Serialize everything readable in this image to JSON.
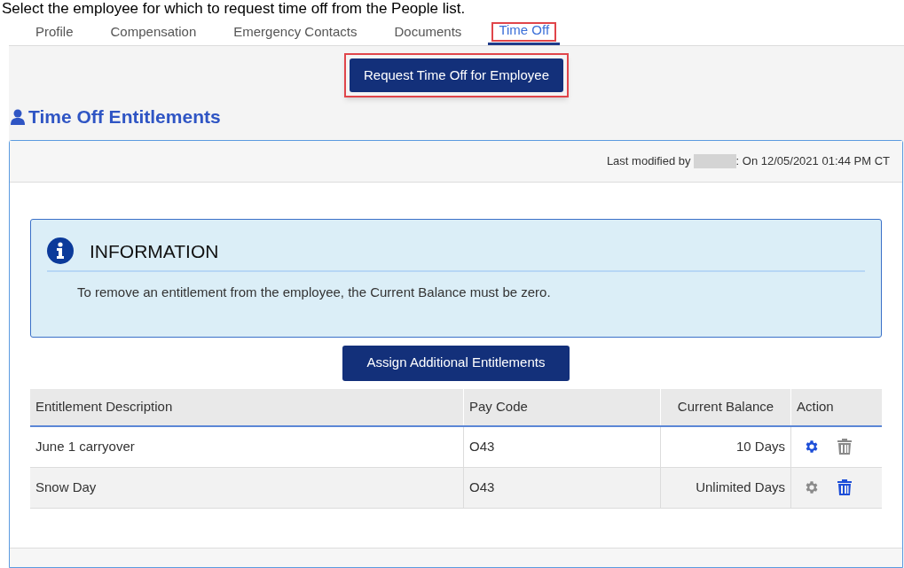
{
  "instruction": "Select the employee for which to request time off from the People list.",
  "tabs": [
    {
      "label": "Profile",
      "selected": false,
      "highlighted": false
    },
    {
      "label": "Compensation",
      "selected": false,
      "highlighted": false
    },
    {
      "label": "Emergency Contacts",
      "selected": false,
      "highlighted": false
    },
    {
      "label": "Documents",
      "selected": false,
      "highlighted": false
    },
    {
      "label": "Time Off",
      "selected": true,
      "highlighted": true
    }
  ],
  "request_button": {
    "label": "Request Time Off for Employee",
    "highlighted": true
  },
  "section_title": "Time Off Entitlements",
  "panel": {
    "modified_prefix": "Last modified by",
    "modified_suffix": ": On 12/05/2021 01:44 PM CT",
    "info": {
      "title": "INFORMATION",
      "text": "To remove an entitlement from the employee, the Current Balance must be zero."
    },
    "assign_button": "Assign Additional Entitlements",
    "table": {
      "columns": [
        "Entitlement Description",
        "Pay Code",
        "Current Balance",
        "Action"
      ],
      "rows": [
        {
          "description": "June 1 carryover",
          "pay_code": "O43",
          "balance": "10 Days",
          "edit_enabled": true,
          "delete_enabled": false
        },
        {
          "description": "Snow Day",
          "pay_code": "O43",
          "balance": "Unlimited Days",
          "edit_enabled": false,
          "delete_enabled": true
        }
      ]
    }
  }
}
